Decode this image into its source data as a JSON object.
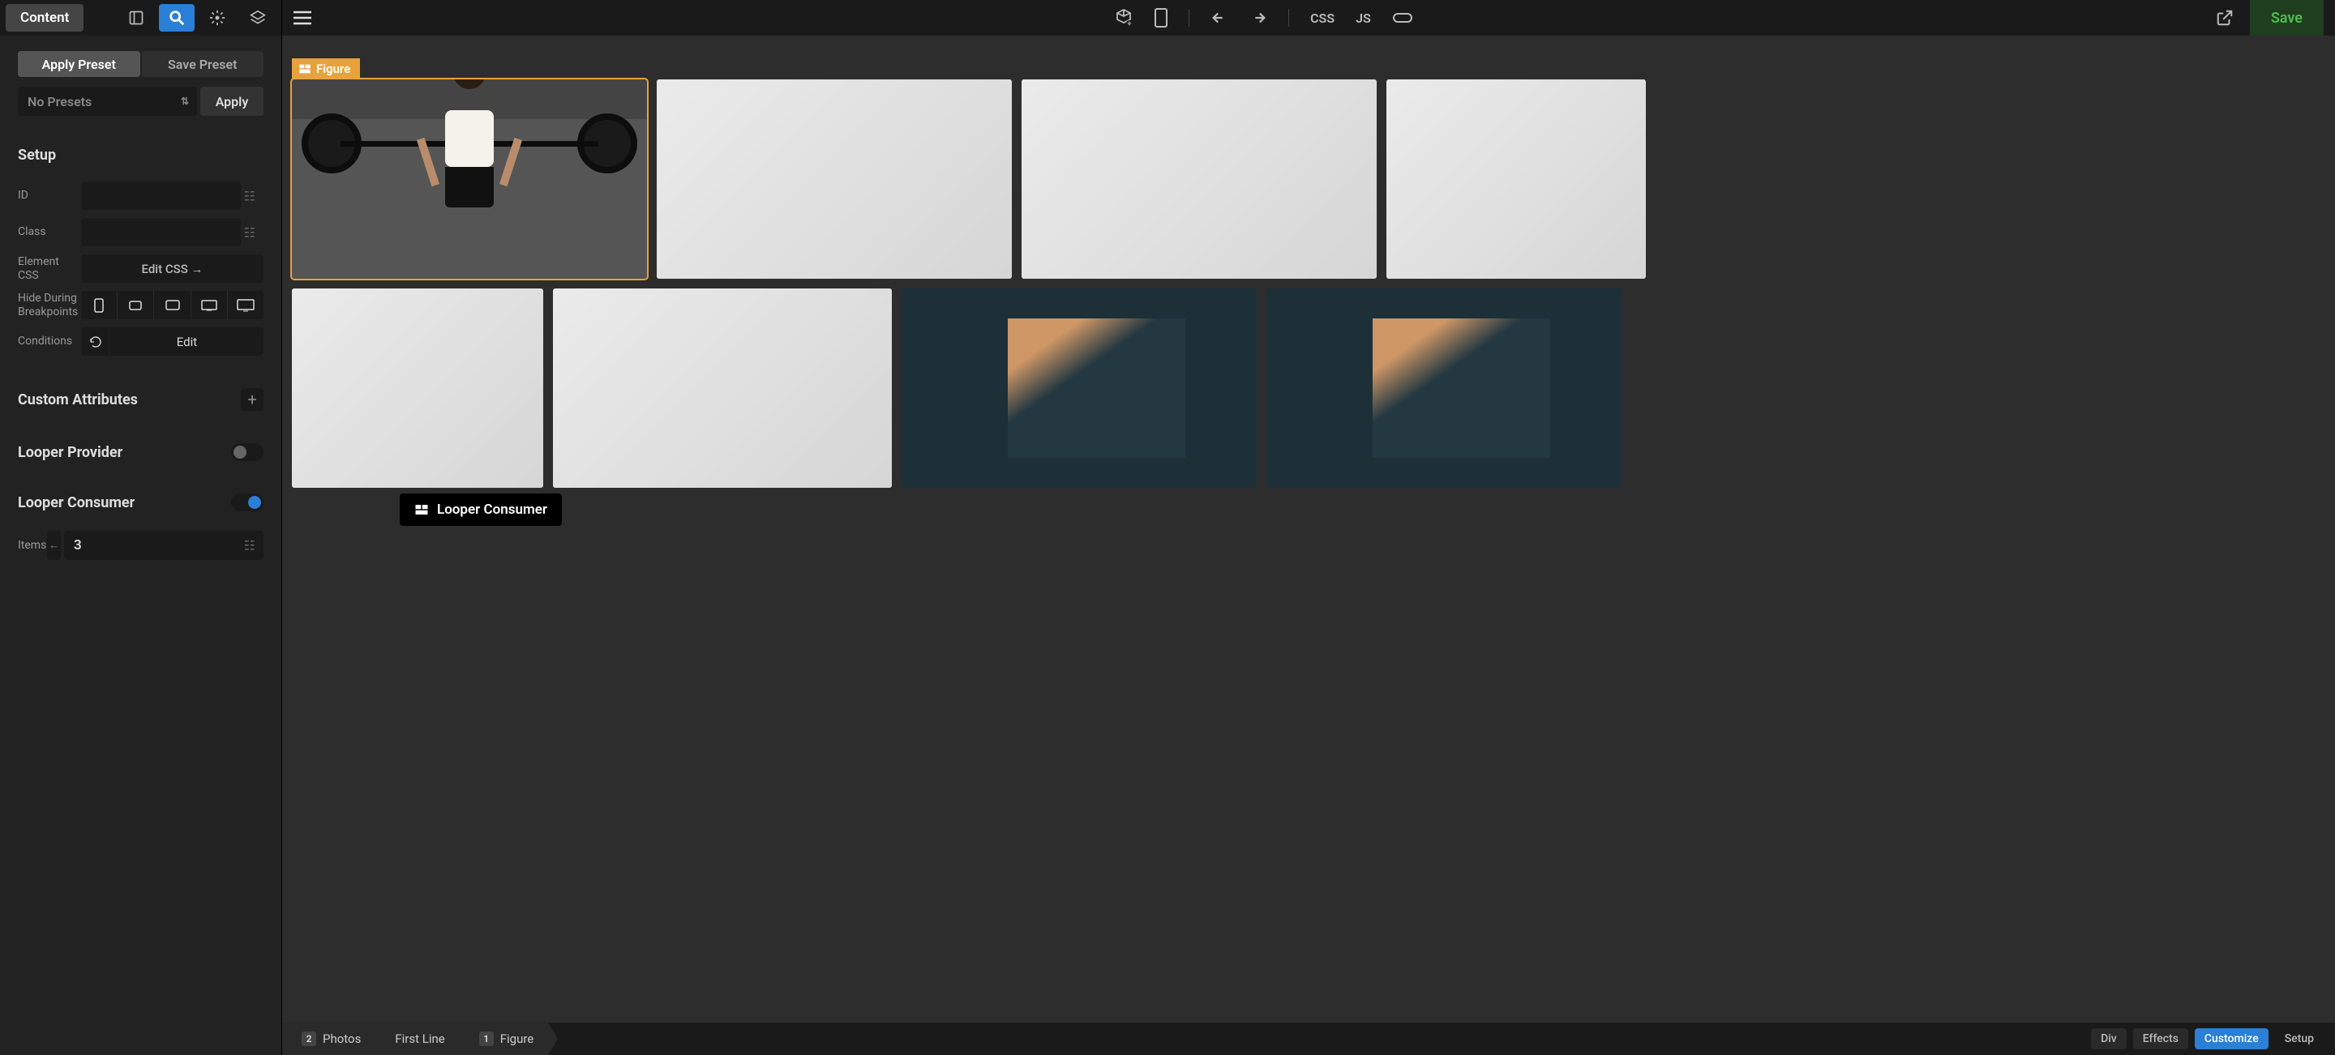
{
  "sidebar": {
    "content_label": "Content",
    "presets": {
      "apply_preset": "Apply Preset",
      "save_preset": "Save Preset",
      "select_placeholder": "No Presets",
      "apply_btn": "Apply"
    },
    "setup": {
      "heading": "Setup",
      "id_label": "ID",
      "id_value": "",
      "class_label": "Class",
      "class_value": "",
      "element_css_label": "Element CSS",
      "edit_css_btn": "Edit CSS →",
      "hide_bp_label": "Hide During Breakpoints",
      "conditions_label": "Conditions",
      "conditions_edit": "Edit"
    },
    "custom_attributes_heading": "Custom Attributes",
    "looper_provider_heading": "Looper Provider",
    "looper_provider_on": false,
    "looper_consumer_heading": "Looper Consumer",
    "looper_consumer_on": true,
    "items_label": "Items",
    "items_value": "3"
  },
  "topbar": {
    "css_label": "CSS",
    "js_label": "JS",
    "save_label": "Save"
  },
  "canvas": {
    "figure_tag": "Figure",
    "looper_badge": "Looper Consumer"
  },
  "breadcrumb": [
    {
      "badge": "2",
      "label": "Photos"
    },
    {
      "badge": "",
      "label": "First Line"
    },
    {
      "badge": "1",
      "label": "Figure"
    }
  ],
  "bottom_actions": {
    "div": "Div",
    "effects": "Effects",
    "customize": "Customize",
    "setup": "Setup"
  }
}
